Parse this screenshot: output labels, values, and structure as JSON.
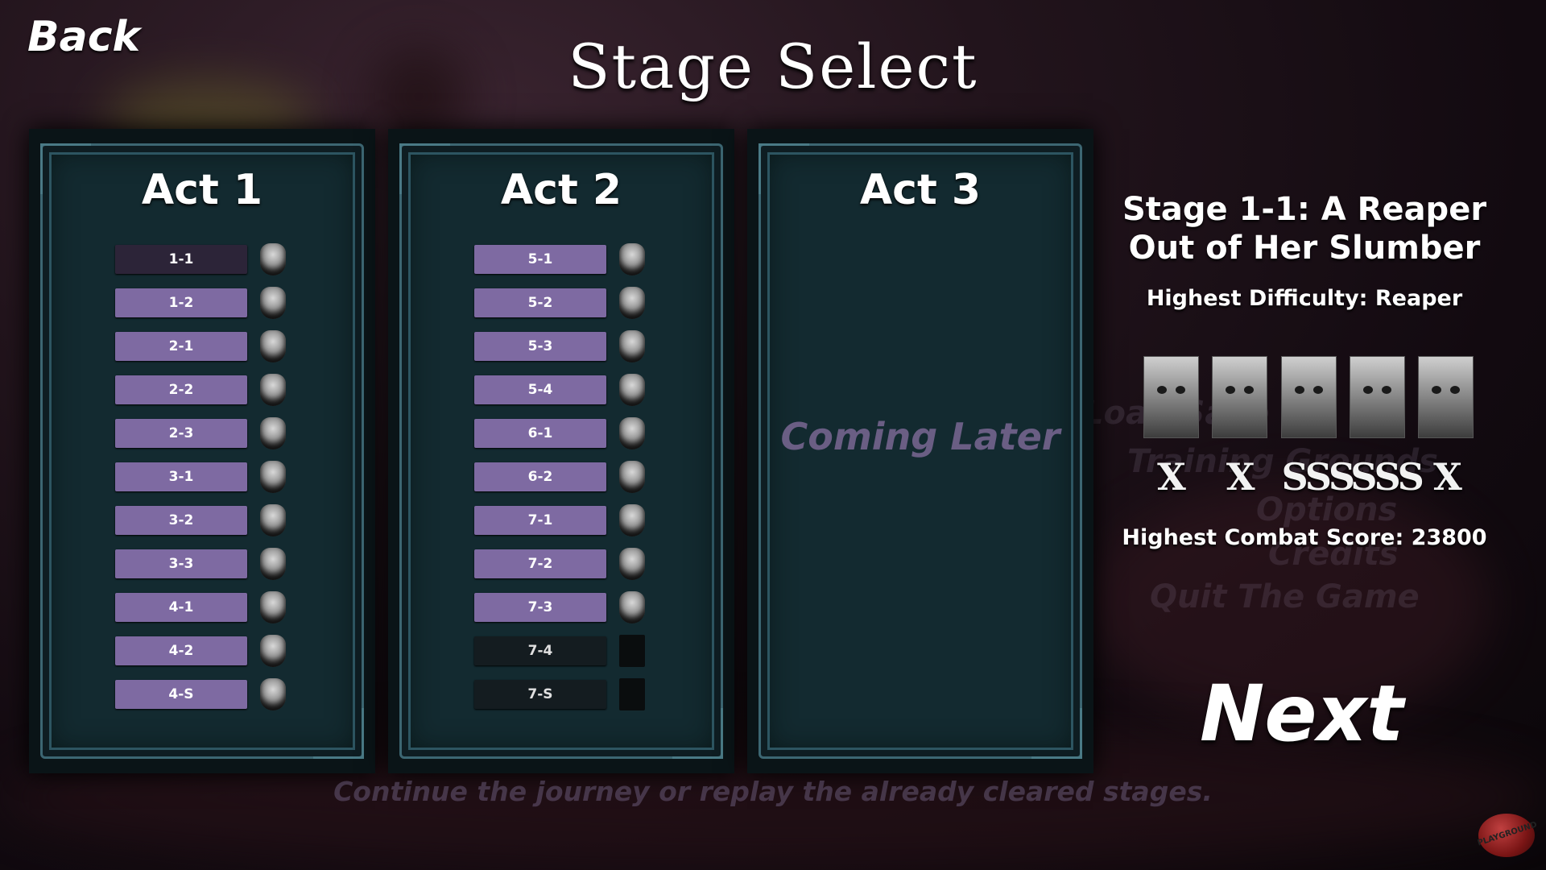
{
  "header": {
    "back_label": "Back",
    "title": "Stage Select"
  },
  "background_menu": [
    "Load Save",
    "Training Grounds",
    "Options",
    "Credits",
    "Quit The Game"
  ],
  "acts": [
    {
      "title": "Act 1",
      "stages": [
        {
          "label": "1-1",
          "state": "selected",
          "mask": true
        },
        {
          "label": "1-2",
          "state": "unlocked",
          "mask": true
        },
        {
          "label": "2-1",
          "state": "unlocked",
          "mask": true
        },
        {
          "label": "2-2",
          "state": "unlocked",
          "mask": true
        },
        {
          "label": "2-3",
          "state": "unlocked",
          "mask": true
        },
        {
          "label": "3-1",
          "state": "unlocked",
          "mask": true
        },
        {
          "label": "3-2",
          "state": "unlocked",
          "mask": true
        },
        {
          "label": "3-3",
          "state": "unlocked",
          "mask": true
        },
        {
          "label": "4-1",
          "state": "unlocked",
          "mask": true
        },
        {
          "label": "4-2",
          "state": "unlocked",
          "mask": true
        },
        {
          "label": "4-S",
          "state": "unlocked",
          "mask": true
        }
      ]
    },
    {
      "title": "Act 2",
      "stages": [
        {
          "label": "5-1",
          "state": "unlocked",
          "mask": true
        },
        {
          "label": "5-2",
          "state": "unlocked",
          "mask": true
        },
        {
          "label": "5-3",
          "state": "unlocked",
          "mask": true
        },
        {
          "label": "5-4",
          "state": "unlocked",
          "mask": true
        },
        {
          "label": "6-1",
          "state": "unlocked",
          "mask": true
        },
        {
          "label": "6-2",
          "state": "unlocked",
          "mask": true
        },
        {
          "label": "7-1",
          "state": "unlocked",
          "mask": true
        },
        {
          "label": "7-2",
          "state": "unlocked",
          "mask": true
        },
        {
          "label": "7-3",
          "state": "unlocked",
          "mask": true
        },
        {
          "label": "7-4",
          "state": "locked",
          "mask": false
        },
        {
          "label": "7-S",
          "state": "locked",
          "mask": false
        }
      ]
    },
    {
      "title": "Act 3",
      "stages": [],
      "coming_label": "Coming Later"
    }
  ],
  "stage_info": {
    "title": "Stage 1-1: A Reaper Out of Her Slumber",
    "highest_difficulty": "Highest Difficulty: Reaper",
    "difficulty_faces": [
      "difficulty-1-face",
      "difficulty-2-face",
      "difficulty-3-face",
      "difficulty-4-face",
      "difficulty-5-face"
    ],
    "ranks": [
      "X",
      "X",
      "SSS",
      "SSS",
      "X"
    ],
    "highest_score": "Highest Combat Score: 23800"
  },
  "next_label": "Next",
  "hint": "Continue the journey or replay the already cleared stages.",
  "watermark": "PLAYGROUND",
  "colors": {
    "stage_button": "#7e6aa2",
    "stage_selected": "#2c2438",
    "coming_later": "#6a5e84",
    "panel_border": "#3c6672"
  }
}
